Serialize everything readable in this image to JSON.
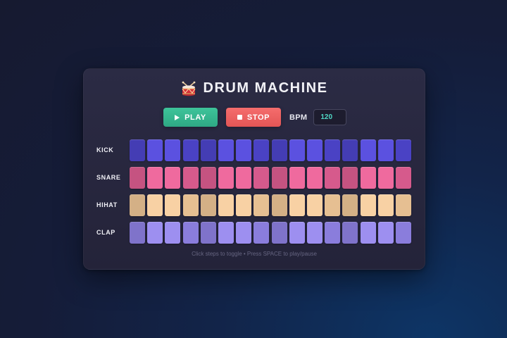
{
  "app": {
    "title": "DRUM MACHINE",
    "icon": "drum-icon"
  },
  "controls": {
    "play_label": "PLAY",
    "stop_label": "STOP",
    "bpm_label": "BPM",
    "bpm_value": "120"
  },
  "tracks": [
    {
      "name": "KICK",
      "color": "#5b51e0",
      "color_dim": "#4a42c4",
      "steps": [
        true,
        true,
        true,
        true,
        true,
        true,
        true,
        true,
        true,
        true,
        true,
        true,
        true,
        true,
        true,
        true
      ]
    },
    {
      "name": "SNARE",
      "color": "#ef6a9e",
      "color_dim": "#d65a8c",
      "steps": [
        true,
        true,
        true,
        true,
        true,
        true,
        true,
        true,
        true,
        true,
        true,
        true,
        true,
        true,
        true,
        true
      ]
    },
    {
      "name": "HIHAT",
      "color": "#f8d1a4",
      "color_dim": "#e6bf92",
      "steps": [
        true,
        true,
        true,
        true,
        true,
        true,
        true,
        true,
        true,
        true,
        true,
        true,
        true,
        true,
        true,
        true
      ]
    },
    {
      "name": "CLAP",
      "color": "#9d8ff0",
      "color_dim": "#8a7ddc",
      "steps": [
        true,
        true,
        true,
        true,
        true,
        true,
        true,
        true,
        true,
        true,
        true,
        true,
        true,
        true,
        true,
        true
      ]
    }
  ],
  "hint": "Click steps to toggle • Press SPACE to play/pause"
}
